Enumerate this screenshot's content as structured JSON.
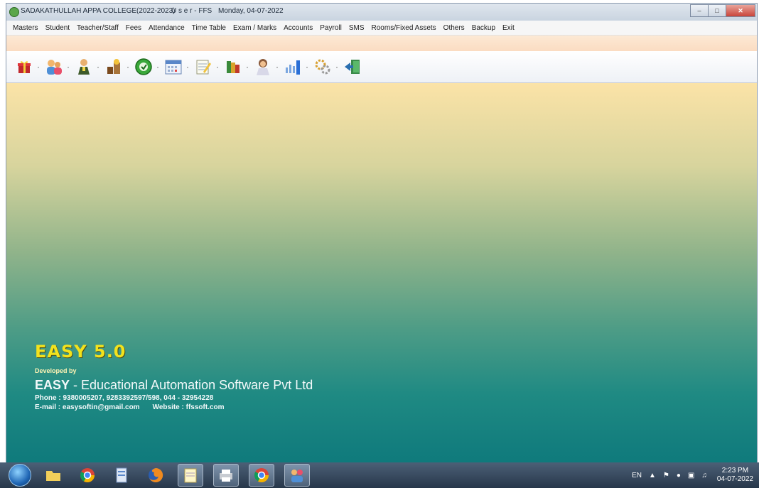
{
  "window": {
    "title": "SADAKATHULLAH APPA COLLEGE(2022-2023)",
    "user": "U s e r - FFS",
    "date": "Monday, 04-07-2022"
  },
  "menu": [
    "Masters",
    "Student",
    "Teacher/Staff",
    "Fees",
    "Attendance",
    "Time Table",
    "Exam / Marks",
    "Accounts",
    "Payroll",
    "SMS",
    "Rooms/Fixed Assets",
    "Others",
    "Backup",
    "Exit"
  ],
  "toolbar_icons": [
    "gift-icon",
    "users-icon",
    "staff-icon",
    "fees-icon",
    "attendance-icon",
    "calendar-icon",
    "notepad-icon",
    "books-icon",
    "teacher-icon",
    "chart-icon",
    "settings-icon",
    "exit-icon"
  ],
  "brand": {
    "title": "EASY 5.0",
    "developed_by": "Developed by",
    "company_bold": "EASY",
    "company_rest": " - Educational Automation Software Pvt Ltd",
    "phone": "Phone : 9380005207, 9283392597/598,  044 - 32954228",
    "email": "E-mail : easysoftin@gmail.com",
    "website": "Website : ffssoft.com"
  },
  "tray": {
    "lang": "EN",
    "time": "2:23 PM",
    "date": "04-07-2022"
  },
  "colors": {
    "brand_yellow": "#f2e21d",
    "gradient_top": "#fbe3a7",
    "gradient_bottom": "#0f7a7c"
  }
}
